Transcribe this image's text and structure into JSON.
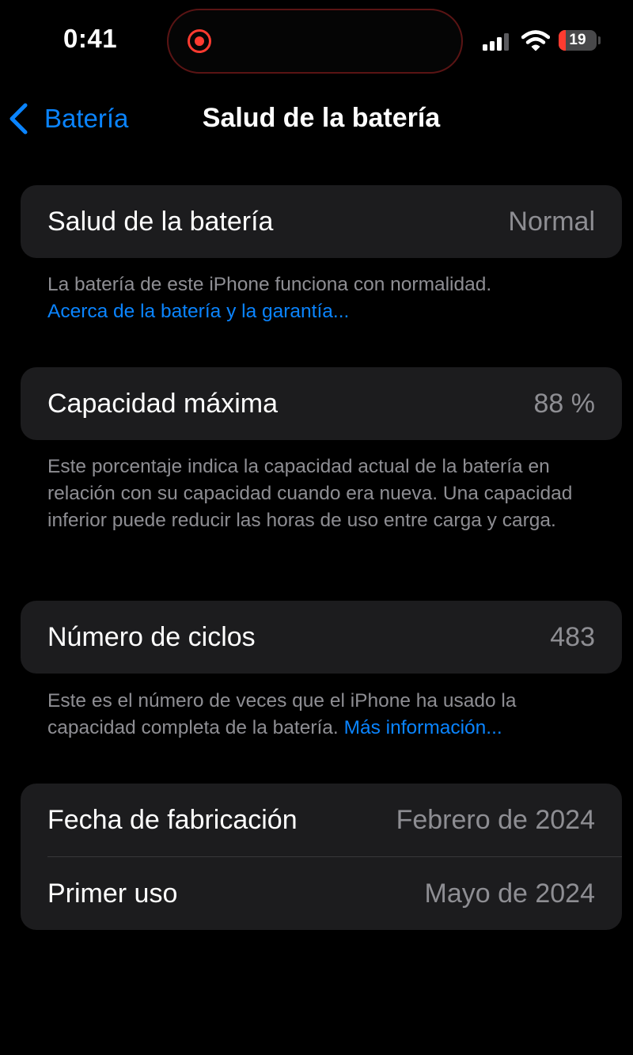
{
  "status_bar": {
    "time": "0:41",
    "battery_level": "19",
    "battery_fraction": 0.19,
    "signal_bars_active": 3,
    "signal_bars_total": 4,
    "icons": [
      "recording-indicator-icon",
      "cellular-signal-icon",
      "wifi-icon",
      "battery-icon"
    ]
  },
  "nav": {
    "back_label": "Batería",
    "title": "Salud de la batería",
    "back_icon": "chevron-left-icon"
  },
  "health": {
    "label": "Salud de la batería",
    "value": "Normal",
    "footnote": "La batería de este iPhone funciona con normalidad.",
    "link": "Acerca de la batería y la garantía..."
  },
  "capacity": {
    "label": "Capacidad máxima",
    "value": "88 %",
    "footnote": "Este porcentaje indica la capacidad actual de la batería en relación con su capacidad cuando era nueva. Una capacidad inferior puede reducir las horas de uso entre carga y carga."
  },
  "cycles": {
    "label": "Número de ciclos",
    "value": "483",
    "footnote": "Este es el número de veces que el iPhone ha usado la capacidad completa de la batería.",
    "link": "Más información..."
  },
  "dates": {
    "manufacture_label": "Fecha de fabricación",
    "manufacture_value": "Febrero de 2024",
    "first_use_label": "Primer uso",
    "first_use_value": "Mayo de 2024"
  },
  "colors": {
    "background": "#000000",
    "card": "#1c1c1e",
    "accent_link": "#0a84ff",
    "secondary_text": "#8e8e93",
    "battery_low": "#ff3b30",
    "recording": "#ff3b30"
  }
}
